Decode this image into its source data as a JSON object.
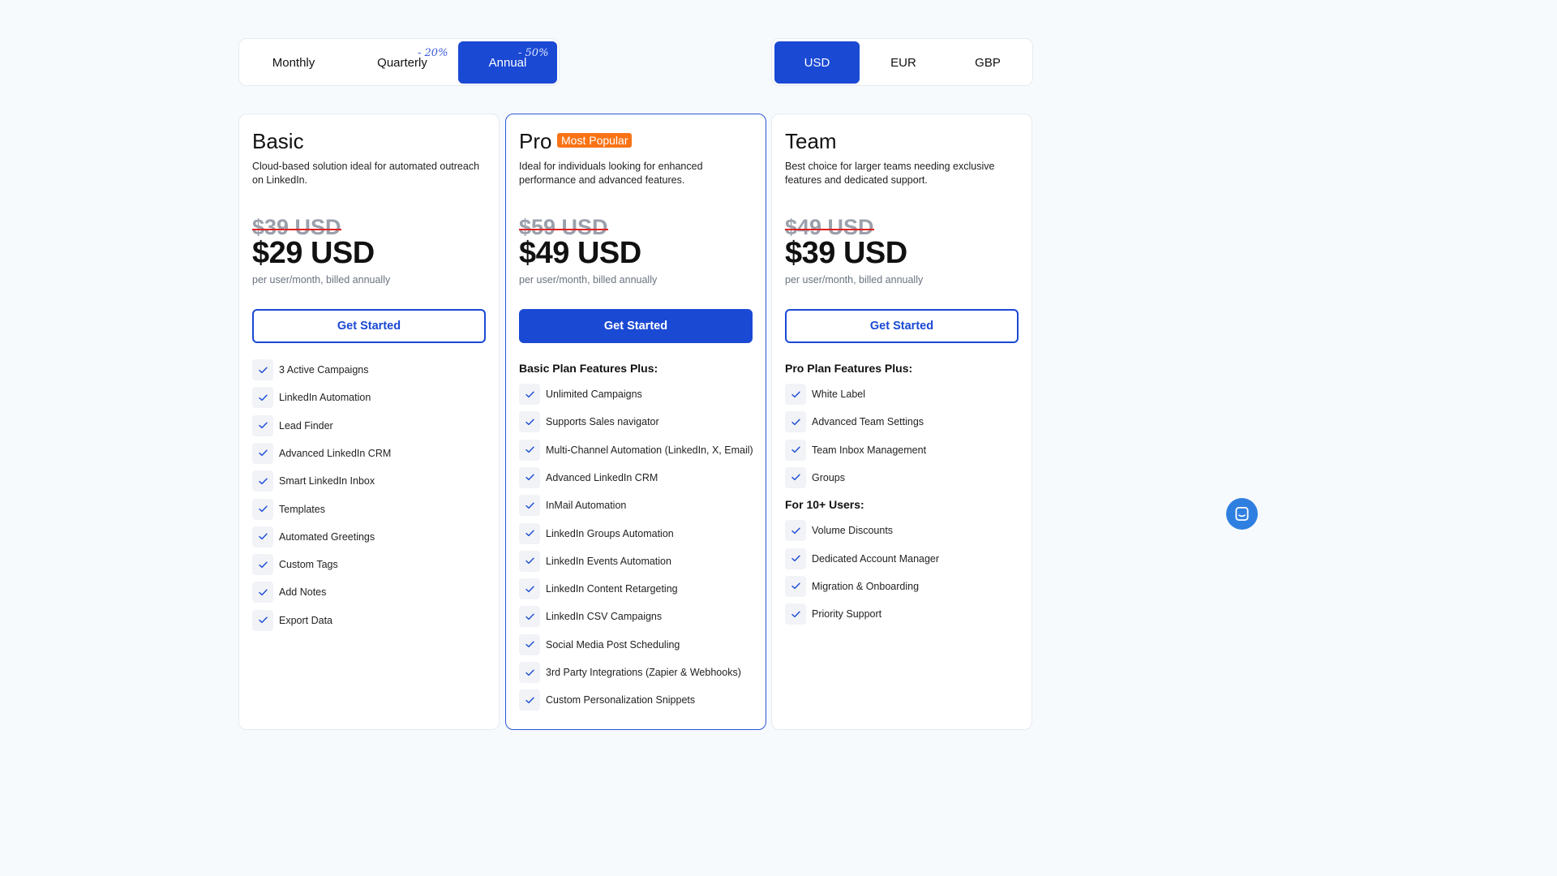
{
  "billing_toggle": {
    "options": [
      {
        "label": "Monthly",
        "discount": ""
      },
      {
        "label": "Quarterly",
        "discount": "- 20%"
      },
      {
        "label": "Annual",
        "discount": "- 50%"
      }
    ],
    "selected": "Annual"
  },
  "currency_toggle": {
    "options": [
      {
        "label": "USD"
      },
      {
        "label": "EUR"
      },
      {
        "label": "GBP"
      }
    ],
    "selected": "USD"
  },
  "colors": {
    "accent": "#1a49d4",
    "badge": "#f97316",
    "strike": "#e02424",
    "chat": "#2f7fe0"
  },
  "plans": [
    {
      "name": "Basic",
      "badge": "",
      "description": "Cloud-based solution ideal for automated outreach on LinkedIn.",
      "old_price": "$39 USD",
      "price": "$29 USD",
      "billing_note": "per user/month, billed annually",
      "cta": "Get Started",
      "sections": [
        {
          "heading": "",
          "features": [
            "3 Active Campaigns",
            "LinkedIn Automation",
            "Lead Finder",
            "Advanced LinkedIn CRM",
            "Smart LinkedIn Inbox",
            "Templates",
            "Automated Greetings",
            "Custom Tags",
            "Add Notes",
            "Export Data"
          ]
        }
      ]
    },
    {
      "name": "Pro",
      "badge": "Most Popular",
      "description": "Ideal for individuals looking for enhanced performance and advanced features.",
      "old_price": "$59 USD",
      "price": "$49 USD",
      "billing_note": "per user/month, billed annually",
      "cta": "Get Started",
      "sections": [
        {
          "heading": "Basic Plan Features Plus:",
          "features": [
            "Unlimited Campaigns",
            "Supports Sales navigator",
            "Multi-Channel Automation (LinkedIn, X, Email)",
            "Advanced LinkedIn CRM",
            "InMail Automation",
            "LinkedIn Groups Automation",
            "LinkedIn Events Automation",
            "LinkedIn Content Retargeting",
            "LinkedIn CSV Campaigns",
            "Social Media Post Scheduling",
            "3rd Party Integrations (Zapier & Webhooks)",
            "Custom Personalization Snippets"
          ]
        }
      ]
    },
    {
      "name": "Team",
      "badge": "",
      "description": "Best choice for larger teams needing exclusive features and dedicated support.",
      "old_price": "$49 USD",
      "price": "$39 USD",
      "billing_note": "per user/month, billed annually",
      "cta": "Get Started",
      "sections": [
        {
          "heading": "Pro Plan Features Plus:",
          "features": [
            "White Label",
            "Advanced Team Settings",
            "Team Inbox Management",
            "Groups"
          ]
        },
        {
          "heading": "For 10+ Users:",
          "features": [
            "Volume Discounts",
            "Dedicated Account Manager",
            "Migration & Onboarding",
            "Priority Support"
          ]
        }
      ]
    }
  ],
  "icons": {
    "check": "check-icon",
    "chat": "chat-icon"
  }
}
